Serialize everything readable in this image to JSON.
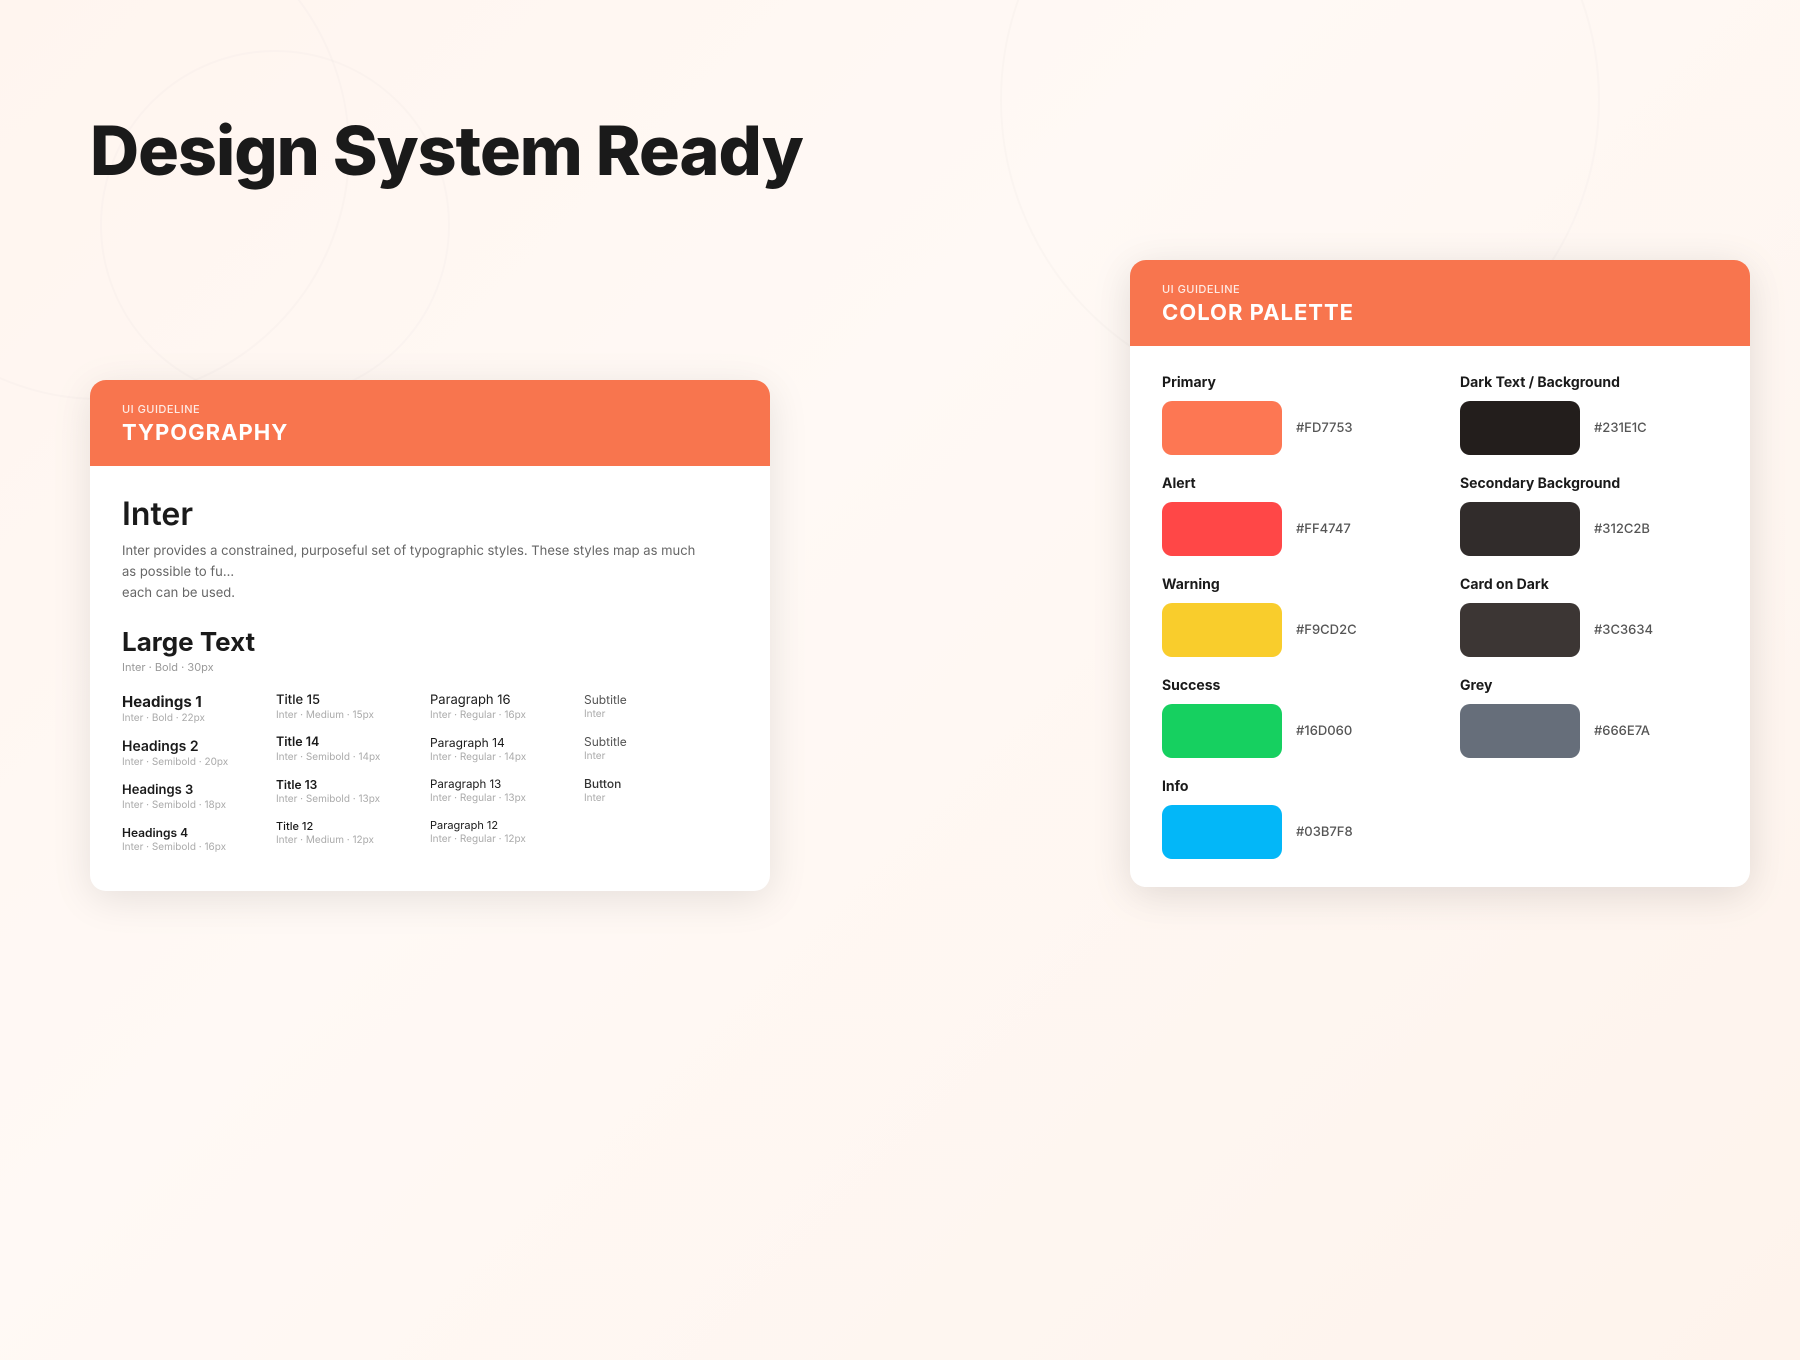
{
  "page": {
    "title": "Design System Ready",
    "background": "#fff5ef"
  },
  "typography_card": {
    "guideline_label": "UI Guideline",
    "title": "TYPOGRAPHY",
    "font_name": "Inter",
    "font_description": "Inter provides a constrained, purposeful set of typographic styles. These styles map as much as possible to fu... each can be used.",
    "large_text_label": "Large Text",
    "large_text_sub": "Inter · Bold · 30px",
    "columns": [
      {
        "items": [
          {
            "name": "Headings 1",
            "sub": "Inter · Bold · 22px"
          },
          {
            "name": "Headings 2",
            "sub": "Inter · Semibold · 20px"
          },
          {
            "name": "Headings 3",
            "sub": "Inter · Semibold · 18px"
          },
          {
            "name": "Headings 4",
            "sub": "Inter · Semibold · 16px"
          }
        ]
      },
      {
        "items": [
          {
            "name": "Title 15",
            "sub": "Inter · Medium · 15px"
          },
          {
            "name": "Title 14",
            "sub": "Inter · Semibold · 14px"
          },
          {
            "name": "Title 13",
            "sub": "Inter · Semibold · 13px"
          },
          {
            "name": "Title 12",
            "sub": "Inter · Medium · 12px"
          }
        ]
      },
      {
        "items": [
          {
            "name": "Paragraph 16",
            "sub": "Inter · Regular · 16px"
          },
          {
            "name": "Paragraph 14",
            "sub": "Inter · Regular · 14px"
          },
          {
            "name": "Paragraph 13",
            "sub": "Inter · Regular · 13px"
          },
          {
            "name": "Paragraph 12",
            "sub": "Inter · Regular · 12px"
          }
        ]
      },
      {
        "items": [
          {
            "name": "Subtitle",
            "sub": "Inter"
          },
          {
            "name": "Subtitle",
            "sub": "Inter"
          },
          {
            "name": "",
            "sub": ""
          },
          {
            "name": "Button",
            "sub": "Inter"
          }
        ]
      }
    ]
  },
  "color_card": {
    "guideline_label": "UI Guideline",
    "title": "COLOR PALETTE",
    "colors_left": [
      {
        "section": "Primary",
        "color": "#FD7753",
        "hex": "#FD7753"
      },
      {
        "section": "Alert",
        "color": "#FF4747",
        "hex": "#FF4747"
      },
      {
        "section": "Warning",
        "color": "#F9CD2C",
        "hex": "#F9CD2C"
      },
      {
        "section": "Success",
        "color": "#16D060",
        "hex": "#16D060"
      },
      {
        "section": "Info",
        "color": "#03B7F8",
        "hex": "#03B7F8"
      }
    ],
    "colors_right": [
      {
        "section": "Dark Text / Background",
        "color": "#231E1C",
        "hex": "#231E1C"
      },
      {
        "section": "Secondary Background",
        "color": "#312C2B",
        "hex": "#312C2B"
      },
      {
        "section": "Card on Dark",
        "color": "#3C3634",
        "hex": "#3C3634"
      },
      {
        "section": "Grey",
        "color": "#666E7A",
        "hex": "#666E7A"
      }
    ]
  }
}
